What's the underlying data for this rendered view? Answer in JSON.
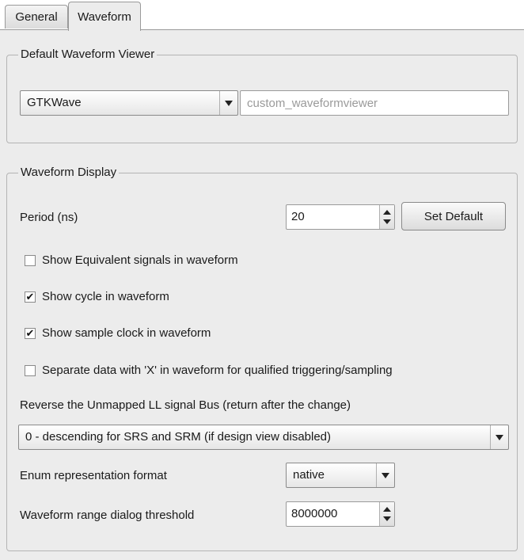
{
  "tabs": [
    {
      "label": "General",
      "active": false
    },
    {
      "label": "Waveform",
      "active": true
    }
  ],
  "viewer_group": {
    "title": "Default Waveform Viewer",
    "viewer_select": "GTKWave",
    "custom_viewer_placeholder": "custom_waveformviewer"
  },
  "display_group": {
    "title": "Waveform Display",
    "period_label": "Period (ns)",
    "period_value": "20",
    "set_default_label": "Set Default",
    "checkboxes": [
      {
        "label": "Show Equivalent signals in waveform",
        "checked": false,
        "mark": ""
      },
      {
        "label": "Show cycle in waveform",
        "checked": true,
        "mark": "✔"
      },
      {
        "label": "Show sample clock in waveform",
        "checked": true,
        "mark": "✔"
      },
      {
        "label": "Separate data with 'X' in waveform for  qualified triggering/sampling",
        "checked": false,
        "mark": ""
      }
    ],
    "reverse_label": "Reverse the Unmapped LL signal Bus (return after the change)",
    "reverse_select": "0 - descending for SRS and SRM (if design view disabled)",
    "enum_label": "Enum representation format",
    "enum_select": "native",
    "threshold_label": "Waveform range dialog threshold",
    "threshold_value": "8000000"
  }
}
